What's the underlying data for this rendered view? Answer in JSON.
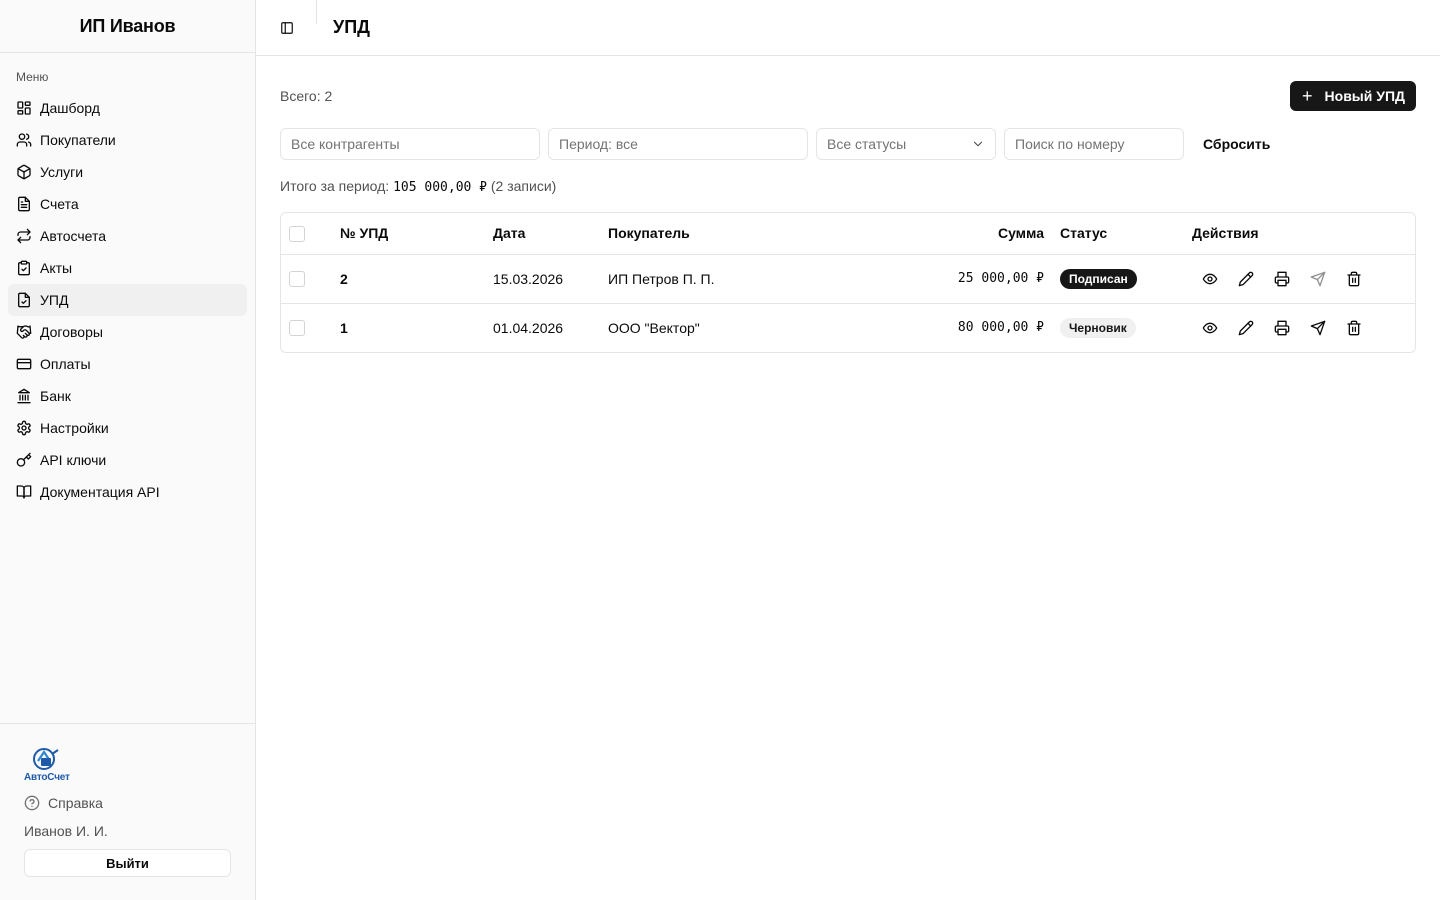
{
  "sidebar": {
    "title": "ИП Иванов",
    "group_label": "Меню",
    "items": [
      {
        "label": "Дашборд",
        "icon": "dashboard-icon"
      },
      {
        "label": "Покупатели",
        "icon": "users-icon"
      },
      {
        "label": "Услуги",
        "icon": "box-icon"
      },
      {
        "label": "Счета",
        "icon": "document-icon"
      },
      {
        "label": "Автосчета",
        "icon": "repeat-icon"
      },
      {
        "label": "Акты",
        "icon": "clipboard-check-icon"
      },
      {
        "label": "УПД",
        "icon": "file-check-icon",
        "active": true
      },
      {
        "label": "Договоры",
        "icon": "handshake-icon"
      },
      {
        "label": "Оплаты",
        "icon": "credit-card-icon"
      },
      {
        "label": "Банк",
        "icon": "bank-icon"
      },
      {
        "label": "Настройки",
        "icon": "gear-icon"
      },
      {
        "label": "API ключи",
        "icon": "key-icon"
      },
      {
        "label": "Документация API",
        "icon": "book-icon"
      }
    ],
    "footer": {
      "logo_text": "АвтоСчет",
      "help_label": "Справка",
      "user_name": "Иванов И. И.",
      "logout_label": "Выйти"
    }
  },
  "topbar": {
    "title": "УПД"
  },
  "content": {
    "total_label": "Всего: 2",
    "new_button_label": "Новый УПД",
    "filters": {
      "contractors_placeholder": "Все контрагенты",
      "period_placeholder": "Период: все",
      "status_value": "Все статусы",
      "search_placeholder": "Поиск по номеру",
      "reset_label": "Сбросить"
    },
    "summary": {
      "prefix": "Итого за период:",
      "amount": "105 000,00 ₽",
      "records": "(2 записи)"
    },
    "table": {
      "headers": {
        "number": "№ УПД",
        "date": "Дата",
        "buyer": "Покупатель",
        "sum": "Сумма",
        "status": "Статус",
        "actions": "Действия"
      },
      "rows": [
        {
          "number": "2",
          "date": "15.03.2026",
          "buyer": "ИП Петров П. П.",
          "sum": "25 000,00 ₽",
          "status": "Подписан",
          "status_kind": "signed",
          "send_enabled": false
        },
        {
          "number": "1",
          "date": "01.04.2026",
          "buyer": "ООО \"Вектор\"",
          "sum": "80 000,00 ₽",
          "status": "Черновик",
          "status_kind": "draft",
          "send_enabled": true
        }
      ]
    }
  },
  "colors": {
    "primary": "#171717",
    "border": "#e5e5e5",
    "sidebar_bg": "#fafafa",
    "logo_blue": "#1e5aa8"
  }
}
